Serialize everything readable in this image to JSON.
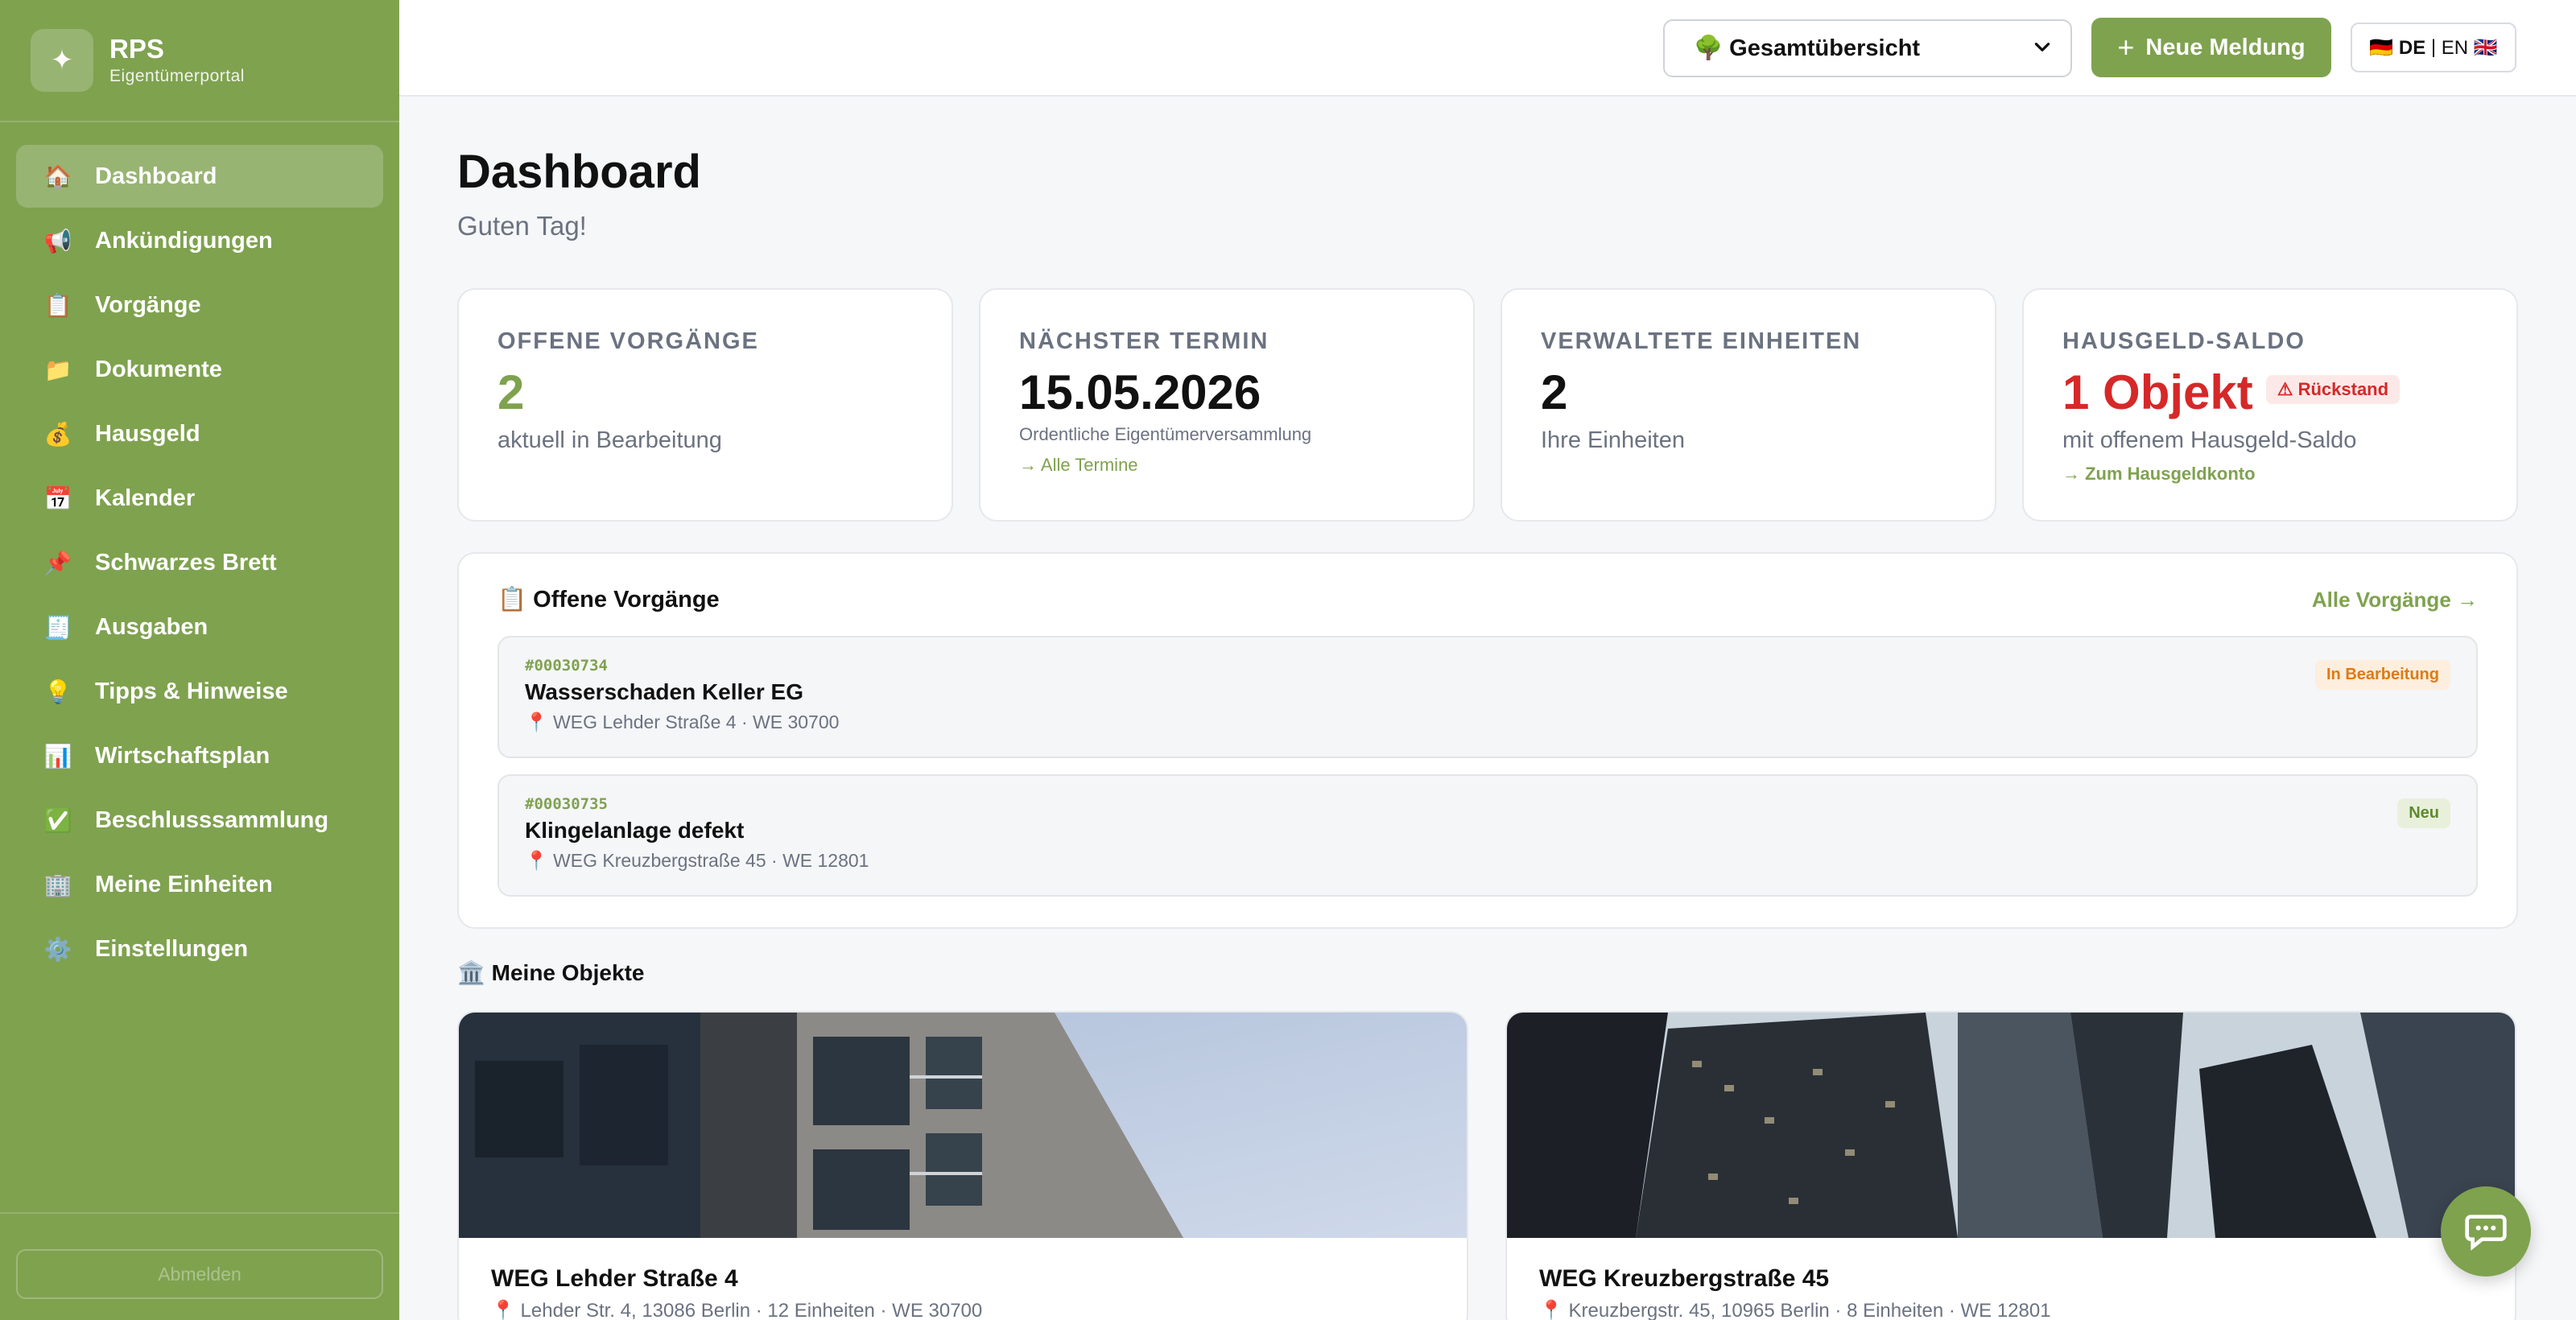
{
  "brand": {
    "logo_glyph": "✦",
    "title": "RPS",
    "subtitle": "Eigentümerportal"
  },
  "sidebar": {
    "items": [
      {
        "icon": "house-icon",
        "glyph": "🏠",
        "label": "Dashboard",
        "active": true
      },
      {
        "icon": "megaphone-icon",
        "glyph": "📢",
        "label": "Ankündigungen"
      },
      {
        "icon": "clipboard-icon",
        "glyph": "📋",
        "label": "Vorgänge"
      },
      {
        "icon": "folder-icon",
        "glyph": "📁",
        "label": "Dokumente"
      },
      {
        "icon": "money-bag-icon",
        "glyph": "💰",
        "label": "Hausgeld"
      },
      {
        "icon": "calendar-icon",
        "glyph": "📅",
        "label": "Kalender"
      },
      {
        "icon": "pushpin-icon",
        "glyph": "📌",
        "label": "Schwarzes Brett"
      },
      {
        "icon": "receipt-icon",
        "glyph": "🧾",
        "label": "Ausgaben"
      },
      {
        "icon": "lightbulb-icon",
        "glyph": "💡",
        "label": "Tipps & Hinweise"
      },
      {
        "icon": "bar-chart-icon",
        "glyph": "📊",
        "label": "Wirtschaftsplan"
      },
      {
        "icon": "check-mark-icon",
        "glyph": "✅",
        "label": "Beschlusssammlung"
      },
      {
        "icon": "office-building-icon",
        "glyph": "🏢",
        "label": "Meine Einheiten"
      },
      {
        "icon": "gear-icon",
        "glyph": "⚙️",
        "label": "Einstellungen"
      }
    ],
    "footer_button": "Abmelden"
  },
  "header": {
    "select_value": "🌳 Gesamtübersicht",
    "new_button": "Neue Meldung",
    "lang_de": "🇩🇪 DE",
    "lang_sep": " | ",
    "lang_en": "EN 🇬🇧"
  },
  "page": {
    "title": "Dashboard",
    "greeting": "Guten Tag!"
  },
  "cards": {
    "open": {
      "label": "OFFENE VORGÄNGE",
      "value": "2",
      "desc": "aktuell in Bearbeitung"
    },
    "next": {
      "label": "NÄCHSTER TERMIN",
      "value": "15.05.2026",
      "desc": "Ordentliche Eigentümerversammlung",
      "link": "→ Alle Termine"
    },
    "units": {
      "label": "VERWALTETE EINHEITEN",
      "value": "2",
      "desc": "Ihre Einheiten"
    },
    "saldo": {
      "label": "HAUSGELD-SALDO",
      "value": "1 Objekt",
      "badge": "⚠ Rückstand",
      "desc": "mit offenem Hausgeld-Saldo",
      "link": "→ Zum Hausgeldkonto"
    }
  },
  "open_issues": {
    "title": "📋 Offene Vorgänge",
    "link": "Alle Vorgänge →",
    "items": [
      {
        "id": "#00030734",
        "title": "Wasserschaden Keller EG",
        "location": "📍 WEG Lehder Straße 4 · WE 30700",
        "status": "In Bearbeitung",
        "status_color": "#e07a10"
      },
      {
        "id": "#00030735",
        "title": "Klingelanlage defekt",
        "location": "📍 WEG Kreuzbergstraße 45 · WE 12801",
        "status": "Neu",
        "status_color": "#5f8a2e"
      }
    ]
  },
  "properties": {
    "title": "🏛️ Meine Objekte",
    "items": [
      {
        "name": "WEG Lehder Straße 4",
        "address": "📍 Lehder Str. 4, 13086 Berlin · 12 Einheiten · WE 30700"
      },
      {
        "name": "WEG Kreuzbergstraße 45",
        "address": "📍 Kreuzbergstr. 45, 10965 Berlin · 8 Einheiten · WE 12801"
      }
    ]
  },
  "colors": {
    "accent": "#7fa24f",
    "danger": "#d62828",
    "warning": "#e07a10"
  }
}
